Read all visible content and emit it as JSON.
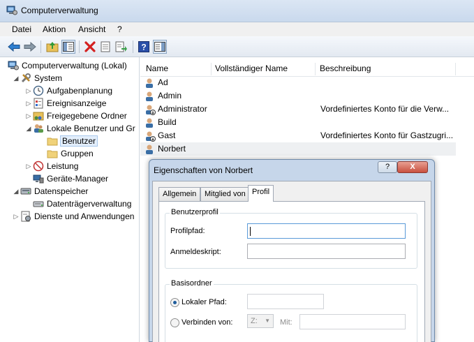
{
  "window": {
    "title": "Computerverwaltung"
  },
  "menu": [
    "Datei",
    "Aktion",
    "Ansicht",
    "?"
  ],
  "toolbar": {
    "icons": [
      "back-arrow-icon",
      "forward-arrow-icon",
      "up-folder-icon",
      "show-hide-tree-icon",
      "delete-icon",
      "properties-icon",
      "export-list-icon",
      "help-icon",
      "action-pane-icon"
    ],
    "delete_color": "#d42020"
  },
  "tree": {
    "root": "Computerverwaltung (Lokal)",
    "system": "System",
    "items": [
      "Aufgabenplanung",
      "Ereignisanzeige",
      "Freigegebene Ordner",
      "Lokale Benutzer und Gr"
    ],
    "users": "Benutzer",
    "groups": "Gruppen",
    "performance": "Leistung",
    "device_manager": "Geräte-Manager",
    "storage": "Datenspeicher",
    "disk_mgmt": "Datenträgerverwaltung",
    "services": "Dienste und Anwendungen"
  },
  "list": {
    "columns": [
      "Name",
      "Vollständiger Name",
      "Beschreibung"
    ],
    "rows": [
      {
        "name": "Ad",
        "description": ""
      },
      {
        "name": "Admin",
        "description": ""
      },
      {
        "name": "Administrator",
        "description": "Vordefiniertes Konto für die Verw..."
      },
      {
        "name": "Build",
        "description": ""
      },
      {
        "name": "Gast",
        "description": "Vordefiniertes Konto für Gastzugri..."
      },
      {
        "name": "Norbert",
        "description": ""
      }
    ]
  },
  "dialog": {
    "title": "Eigenschaften von Norbert",
    "help": "?",
    "close": "X",
    "tabs": [
      "Allgemein",
      "Mitglied von",
      "Profil"
    ],
    "active_tab": "Profil",
    "profile_group": "Benutzerprofil",
    "profile_path_label": "Profilpfad:",
    "profile_path_value": "",
    "logon_script_label": "Anmeldeskript:",
    "logon_script_value": "",
    "home_group": "Basisordner",
    "local_path_label": "Lokaler Pfad:",
    "connect_label": "Verbinden von:",
    "drive_value": "Z:",
    "with_label": "Mit:"
  }
}
